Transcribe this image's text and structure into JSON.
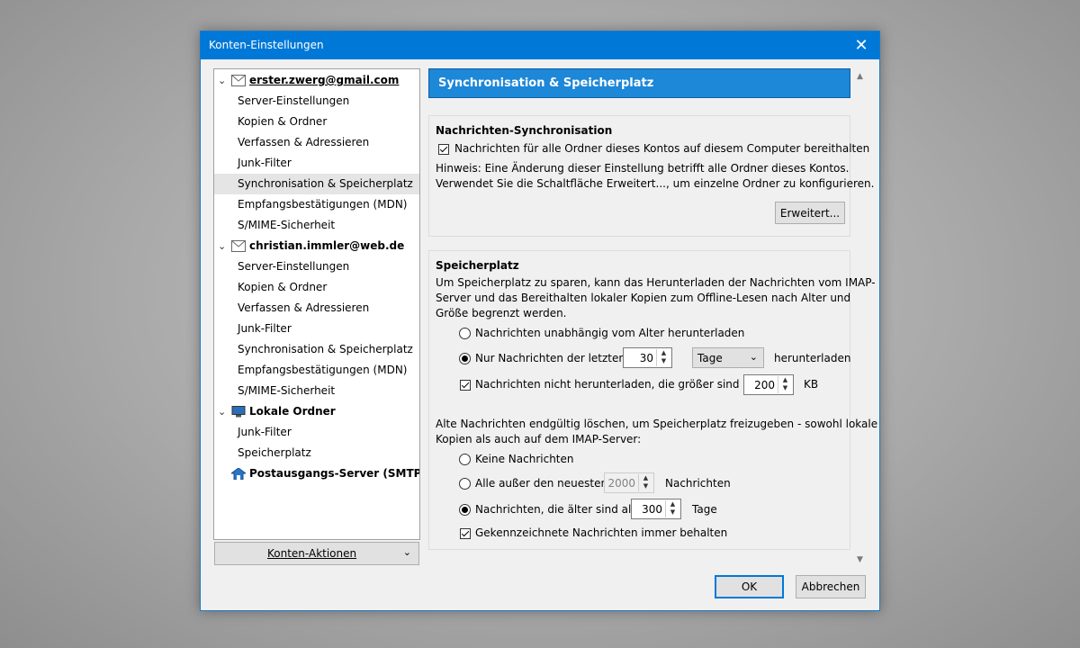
{
  "window": {
    "title": "Konten-Einstellungen"
  },
  "tree": {
    "accounts": [
      {
        "label": "erster.zwerg@gmail.com",
        "items": [
          "Server-Einstellungen",
          "Kopien & Ordner",
          "Verfassen & Adressieren",
          "Junk-Filter",
          "Synchronisation & Speicherplatz",
          "Empfangsbestätigungen (MDN)",
          "S/MIME-Sicherheit"
        ]
      },
      {
        "label": "christian.immler@web.de",
        "items": [
          "Server-Einstellungen",
          "Kopien & Ordner",
          "Verfassen & Adressieren",
          "Junk-Filter",
          "Synchronisation & Speicherplatz",
          "Empfangsbestätigungen (MDN)",
          "S/MIME-Sicherheit"
        ]
      },
      {
        "label": "Lokale Ordner",
        "items": [
          "Junk-Filter",
          "Speicherplatz"
        ]
      }
    ],
    "smtp_label": "Postausgangs-Server (SMTP)",
    "selected": "Synchronisation & Speicherplatz"
  },
  "account_actions": "Konten-Aktionen",
  "panel_title": "Synchronisation & Speicherplatz",
  "sync": {
    "header": "Nachrichten-Synchronisation",
    "keep_label": "Nachrichten für alle Ordner dieses Kontos auf diesem Computer bereithalten",
    "hint1": "Hinweis: Eine Änderung dieser Einstellung betrifft alle Ordner dieses Kontos.",
    "hint2": "Verwendet Sie die Schaltfläche Erweitert..., um einzelne Ordner zu konfigurieren.",
    "advanced_button": "Erweitert..."
  },
  "storage": {
    "header": "Speicherplatz",
    "desc1": "Um Speicherplatz zu sparen, kann das Herunterladen der Nachrichten vom IMAP-",
    "desc2": "Server und das Bereithalten lokaler Kopien zum Offline-Lesen nach Alter und",
    "desc3": "Größe begrenzt werden.",
    "opt_all": "Nachrichten unabhängig vom Alter herunterladen",
    "opt_last": "Nur Nachrichten der letzten",
    "last_value": "30",
    "unit_value": "Tage",
    "download_suffix": "herunterladen",
    "size_label": "Nachrichten nicht herunterladen, die größer sind als",
    "size_value": "200",
    "size_unit": "KB",
    "delete_desc1": "Alte Nachrichten endgültig löschen, um Speicherplatz freizugeben - sowohl lokale",
    "delete_desc2": "Kopien als auch auf dem IMAP-Server:",
    "del_none": "Keine Nachrichten",
    "del_except": "Alle außer den neuesten",
    "except_value": "2000",
    "except_suffix": "Nachrichten",
    "del_older": "Nachrichten, die älter sind als",
    "older_value": "300",
    "older_suffix": "Tage",
    "keep_flagged": "Gekennzeichnete Nachrichten immer behalten"
  },
  "buttons": {
    "ok": "OK",
    "cancel": "Abbrechen"
  }
}
